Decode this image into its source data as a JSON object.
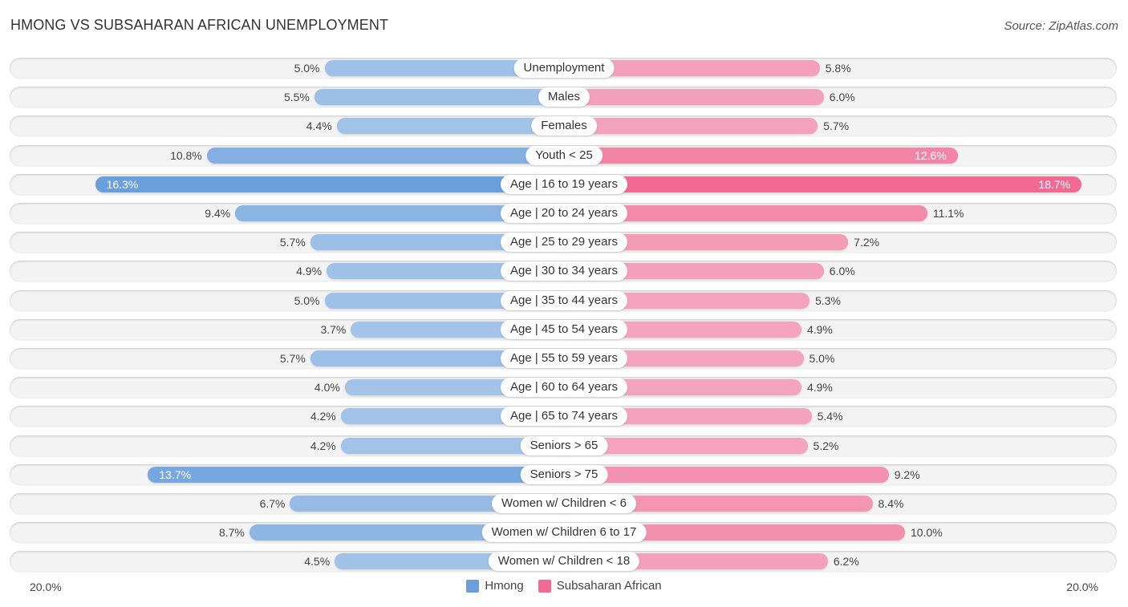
{
  "header": {
    "title": "HMONG VS SUBSAHARAN AFRICAN UNEMPLOYMENT",
    "source": "Source: ZipAtlas.com"
  },
  "colors": {
    "hmong": "#6a9fdb",
    "hmong_light": "#a3c4e8",
    "subsaharan": "#f06a94",
    "subsaharan_light": "#f5a8c2"
  },
  "chart_data": {
    "type": "bar",
    "orientation": "horizontal-diverging",
    "title": "HMONG VS SUBSAHARAN AFRICAN UNEMPLOYMENT",
    "source": "Source: ZipAtlas.com",
    "categories": [
      "Unemployment",
      "Males",
      "Females",
      "Youth < 25",
      "Age | 16 to 19 years",
      "Age | 20 to 24 years",
      "Age | 25 to 29 years",
      "Age | 30 to 34 years",
      "Age | 35 to 44 years",
      "Age | 45 to 54 years",
      "Age | 55 to 59 years",
      "Age | 60 to 64 years",
      "Age | 65 to 74 years",
      "Seniors > 65",
      "Seniors > 75",
      "Women w/ Children < 6",
      "Women w/ Children 6 to 17",
      "Women w/ Children < 18"
    ],
    "series": [
      {
        "name": "Hmong",
        "side": "left",
        "values": [
          5.0,
          5.5,
          4.4,
          10.8,
          16.3,
          9.4,
          5.7,
          4.9,
          5.0,
          3.7,
          5.7,
          4.0,
          4.2,
          4.2,
          13.7,
          6.7,
          8.7,
          4.5
        ],
        "labels": [
          "5.0%",
          "5.5%",
          "4.4%",
          "10.8%",
          "16.3%",
          "9.4%",
          "5.7%",
          "4.9%",
          "5.0%",
          "3.7%",
          "5.7%",
          "4.0%",
          "4.2%",
          "4.2%",
          "13.7%",
          "6.7%",
          "8.7%",
          "4.5%"
        ]
      },
      {
        "name": "Subsaharan African",
        "side": "right",
        "values": [
          5.8,
          6.0,
          5.7,
          12.6,
          18.7,
          11.1,
          7.2,
          6.0,
          5.3,
          4.9,
          5.0,
          4.9,
          5.4,
          5.2,
          9.2,
          8.4,
          10.0,
          6.2
        ],
        "labels": [
          "5.8%",
          "6.0%",
          "5.7%",
          "12.6%",
          "18.7%",
          "11.1%",
          "7.2%",
          "6.0%",
          "5.3%",
          "4.9%",
          "5.0%",
          "4.9%",
          "5.4%",
          "5.2%",
          "9.2%",
          "8.4%",
          "10.0%",
          "6.2%"
        ]
      }
    ],
    "axis": {
      "left_label": "20.0%",
      "right_label": "20.0%",
      "max": 20.0
    },
    "unit": "%",
    "legend": {
      "position": "bottom-center",
      "items": [
        "Hmong",
        "Subsaharan African"
      ]
    }
  }
}
